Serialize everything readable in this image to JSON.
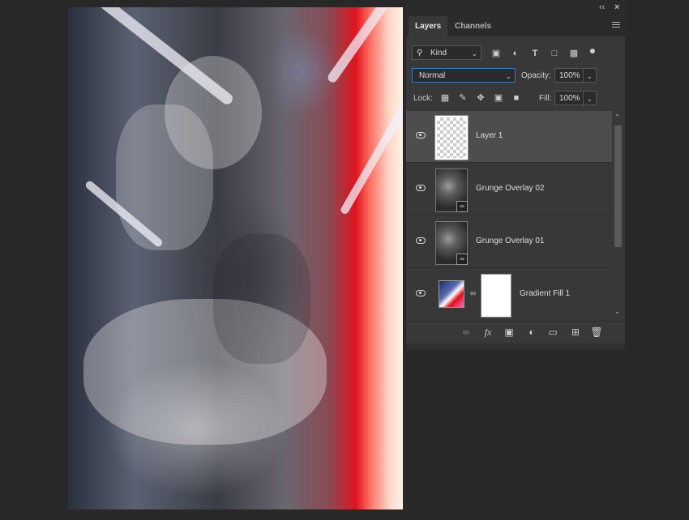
{
  "window": {
    "collapse_glyph": "‹‹",
    "close_glyph": "×"
  },
  "tabs": [
    {
      "label": "Layers",
      "active": true
    },
    {
      "label": "Channels",
      "active": false
    }
  ],
  "filter": {
    "kind_label": "Kind",
    "icons": [
      "image-filter-icon",
      "adjustment-filter-icon",
      "type-filter-icon",
      "shape-filter-icon",
      "smart-object-filter-icon",
      "filter-toggle-icon"
    ]
  },
  "blend": {
    "mode": "Normal",
    "opacity_label": "Opacity:",
    "opacity_value": "100%",
    "lock_label": "Lock:",
    "fill_label": "Fill:",
    "fill_value": "100%"
  },
  "layers": [
    {
      "name": "Layer 1",
      "selected": true,
      "visible": true,
      "thumb": "transparent"
    },
    {
      "name": "Grunge Overlay 02",
      "selected": false,
      "visible": true,
      "thumb": "smart-object"
    },
    {
      "name": "Grunge Overlay 01",
      "selected": false,
      "visible": true,
      "thumb": "smart-object"
    },
    {
      "name": "Gradient Fill 1",
      "selected": false,
      "visible": true,
      "thumb": "gradient-fill"
    }
  ],
  "footer_icons": [
    "link-layers-icon",
    "fx-icon",
    "add-mask-icon",
    "adjustment-layer-icon",
    "new-group-icon",
    "new-layer-icon",
    "delete-layer-icon"
  ],
  "colors": {
    "app_bg": "#282828",
    "panel_bg": "#383838",
    "selected_row": "#4d4d4d",
    "focus_border": "#3a78c8"
  }
}
